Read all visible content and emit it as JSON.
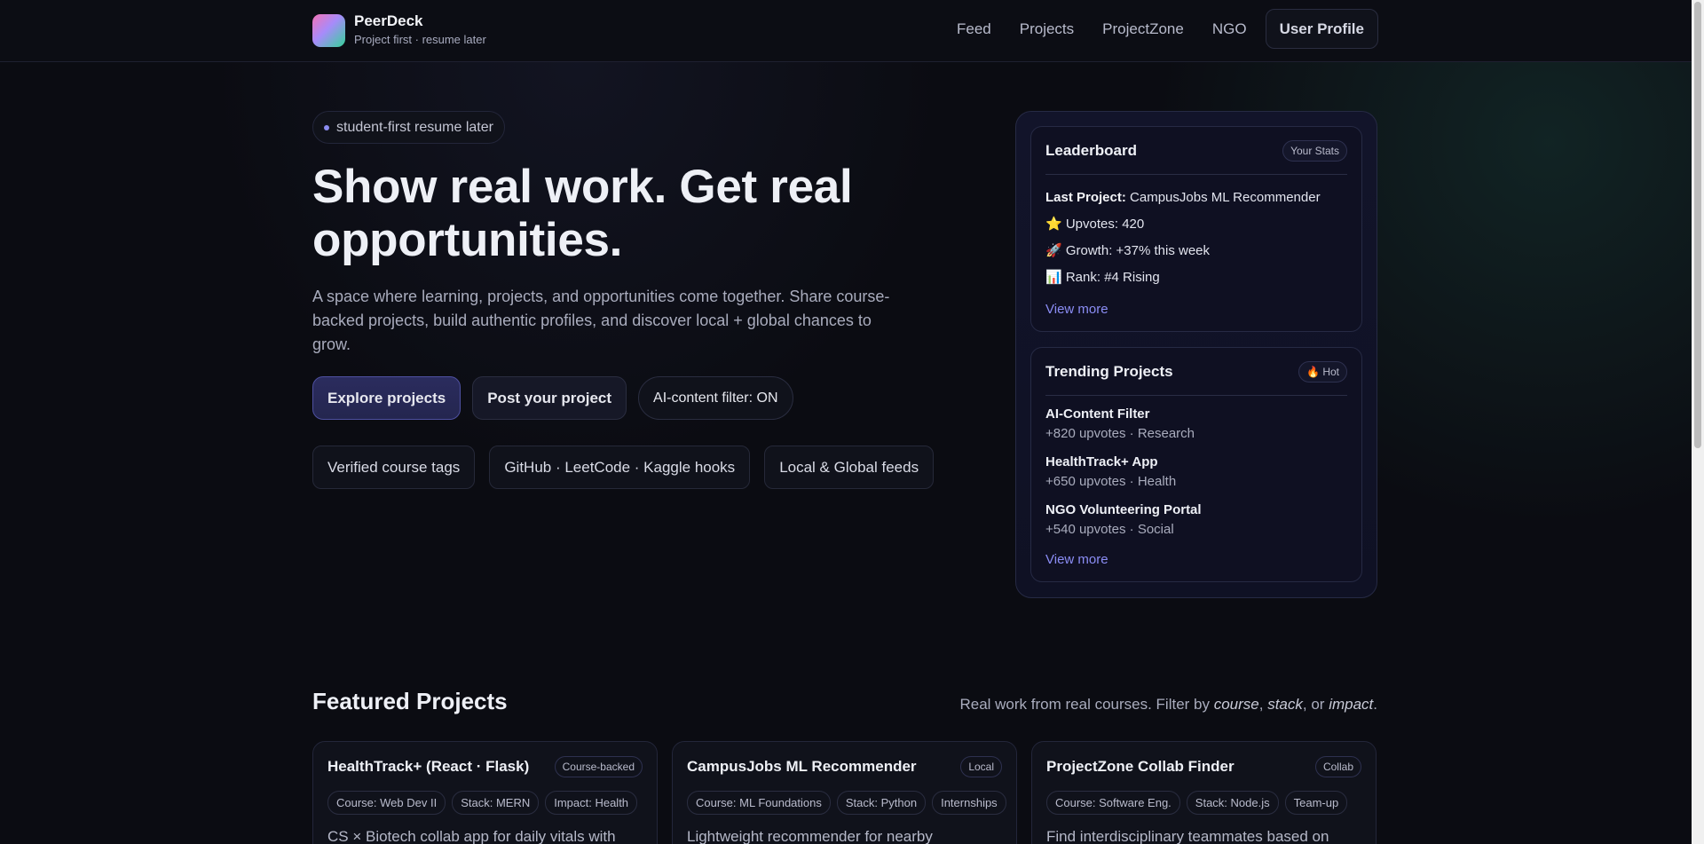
{
  "brand": {
    "name": "PeerDeck",
    "tagline": "Project first · resume later",
    "logo_gradient": [
      "#f472b6",
      "#a78bfa",
      "#34d399"
    ]
  },
  "nav": {
    "items": [
      "Feed",
      "Projects",
      "ProjectZone",
      "NGO"
    ],
    "profile_label": "User Profile"
  },
  "hero": {
    "pill": "student-first resume later",
    "title": "Show real work. Get real opportunities.",
    "lead": "A space where learning, projects, and opportunities come together. Share course-backed projects, build authentic profiles, and discover local + global chances to grow.",
    "buttons": {
      "explore": "Explore projects",
      "post": "Post your project",
      "ai_filter": "AI-content filter: ON"
    },
    "tags": [
      "Verified course tags",
      "GitHub · LeetCode · Kaggle hooks",
      "Local & Global feeds"
    ]
  },
  "leaderboard": {
    "title": "Leaderboard",
    "badge": "Your Stats",
    "last_project_label": "Last Project:",
    "last_project_value": "CampusJobs ML Recommender",
    "upvotes": "⭐ Upvotes: 420",
    "growth": "🚀 Growth: +37% this week",
    "rank": "📊 Rank: #4 Rising",
    "view_more": "View more"
  },
  "trending": {
    "title": "Trending Projects",
    "badge": "🔥 Hot",
    "items": [
      {
        "name": "AI-Content Filter",
        "meta": "+820 upvotes · Research"
      },
      {
        "name": "HealthTrack+ App",
        "meta": "+650 upvotes · Health"
      },
      {
        "name": "NGO Volunteering Portal",
        "meta": "+540 upvotes · Social"
      }
    ],
    "view_more": "View more"
  },
  "featured": {
    "title": "Featured Projects",
    "subtitle_prefix": "Real work from real courses. Filter by ",
    "subtitle_course": "course",
    "subtitle_sep1": ", ",
    "subtitle_stack": "stack",
    "subtitle_sep2": ", or ",
    "subtitle_impact": "impact",
    "subtitle_end": ".",
    "cards": [
      {
        "title": "HealthTrack+ (React · Flask)",
        "badge": "Course-backed",
        "chips": [
          "Course: Web Dev II",
          "Stack: MERN",
          "Impact: Health"
        ],
        "desc": "CS × Biotech collab app for daily vitals with"
      },
      {
        "title": "CampusJobs ML Recommender",
        "badge": "Local",
        "chips": [
          "Course: ML Foundations",
          "Stack: Python",
          "Internships"
        ],
        "desc": "Lightweight recommender for nearby"
      },
      {
        "title": "ProjectZone Collab Finder",
        "badge": "Collab",
        "chips": [
          "Course: Software Eng.",
          "Stack: Node.js",
          "Team-up"
        ],
        "desc": "Find interdisciplinary teammates based on"
      }
    ]
  }
}
